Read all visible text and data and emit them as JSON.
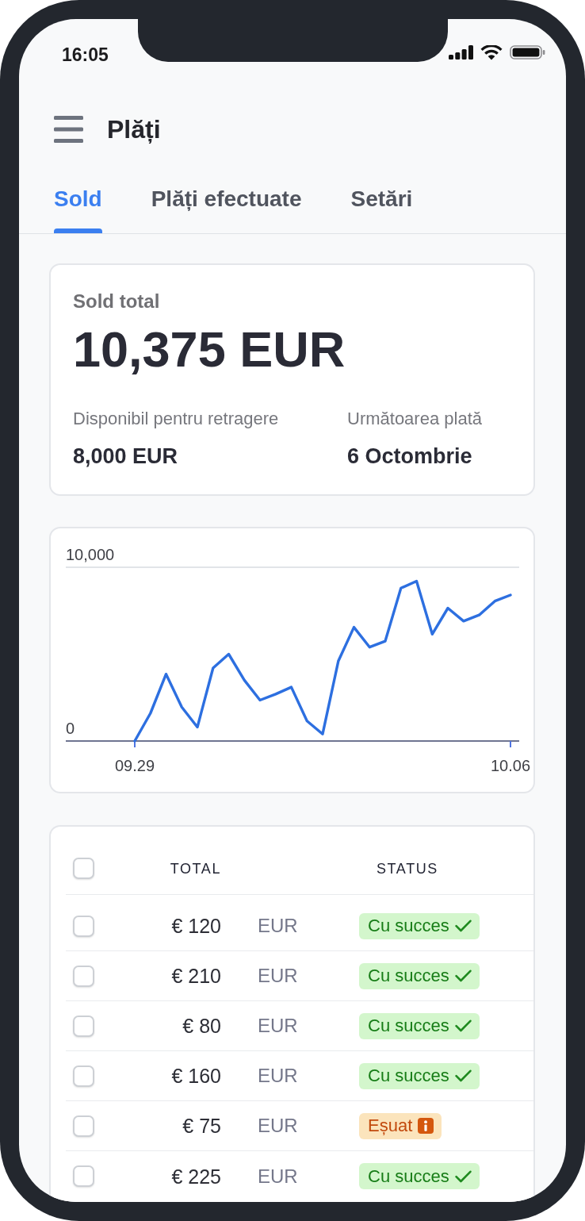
{
  "status_bar": {
    "time": "16:05"
  },
  "header": {
    "title": "Plăți"
  },
  "tabs": [
    {
      "label": "Sold",
      "selected": true
    },
    {
      "label": "Plăți efectuate",
      "selected": false
    },
    {
      "label": "Setări",
      "selected": false
    }
  ],
  "balance_card": {
    "label": "Sold total",
    "amount": "10,375 EUR",
    "details": [
      {
        "label": "Disponibil pentru retragere",
        "value": "8,000 EUR"
      },
      {
        "label": "Următoarea plată",
        "value": "6 Octombrie"
      }
    ]
  },
  "balance_chart": {
    "chart_data": {
      "type": "line",
      "categories": [
        "09.29",
        null,
        null,
        null,
        null,
        null,
        null,
        null,
        null,
        null,
        null,
        null,
        null,
        null,
        null,
        null,
        null,
        null,
        null,
        null,
        null,
        null,
        null,
        null,
        "10.06"
      ],
      "series": [
        {
          "color": "#2d6fe0",
          "values": [
            0,
            1600,
            3850,
            1950,
            800,
            4200,
            5000,
            3500,
            2350,
            2700,
            3100,
            1150,
            400,
            4600,
            6550,
            5400,
            5750,
            8800,
            9200,
            6150,
            7650,
            6900,
            7250,
            8050,
            8400
          ]
        }
      ],
      "ylim": [
        0,
        10000
      ],
      "yticks": [
        {
          "value": 0,
          "label": "0"
        },
        {
          "value": 10000,
          "label": "10,000"
        }
      ]
    }
  },
  "table": {
    "select_all": {
      "checked": false
    },
    "columns": [
      "TOTAL",
      "STATUS"
    ],
    "rows": [
      {
        "checked": false,
        "amount": "€ 120",
        "currency": "EUR",
        "status": {
          "kind": "success",
          "label": "Cu succes"
        }
      },
      {
        "checked": false,
        "amount": "€ 210",
        "currency": "EUR",
        "status": {
          "kind": "success",
          "label": "Cu succes"
        }
      },
      {
        "checked": false,
        "amount": "€ 80",
        "currency": "EUR",
        "status": {
          "kind": "success",
          "label": "Cu succes"
        }
      },
      {
        "checked": false,
        "amount": "€ 160",
        "currency": "EUR",
        "status": {
          "kind": "success",
          "label": "Cu succes"
        }
      },
      {
        "checked": false,
        "amount": "€ 75",
        "currency": "EUR",
        "status": {
          "kind": "failed",
          "label": "Eșuat"
        }
      },
      {
        "checked": false,
        "amount": "€ 225",
        "currency": "EUR",
        "status": {
          "kind": "success",
          "label": "Cu succes"
        }
      }
    ]
  }
}
